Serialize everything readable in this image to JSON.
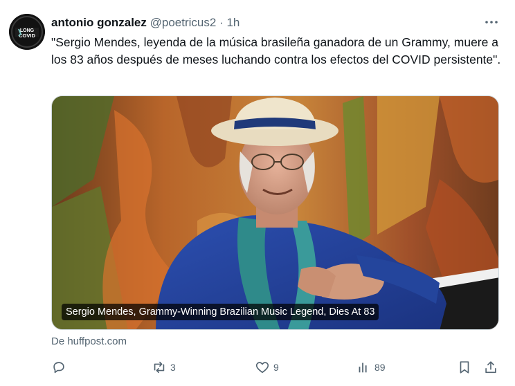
{
  "tweet": {
    "author_name": "antonio gonzalez",
    "handle": "@poetricus2",
    "separator": "·",
    "time": "1h",
    "avatar_text_top": "LONG",
    "avatar_text_bottom": "COVID",
    "text": "\"Sergio Mendes, leyenda de la música brasileña ganadora de un Grammy, muere a los 83 años después de meses luchando contra los efectos del COVID persistente\"."
  },
  "card": {
    "headline": "Sergio Mendes, Grammy-Winning Brazilian Music Legend, Dies At 83",
    "source": "De huffpost.com"
  },
  "actions": {
    "reply_count": "",
    "retweet_count": "3",
    "like_count": "9",
    "views_count": "89"
  },
  "icons": {
    "more": "more-dots-icon",
    "reply": "reply-icon",
    "retweet": "retweet-icon",
    "like": "heart-icon",
    "views": "views-icon",
    "bookmark": "bookmark-icon",
    "share": "share-icon"
  },
  "colors": {
    "text_primary": "#0f1419",
    "text_secondary": "#536471",
    "border": "#cfd9de"
  }
}
